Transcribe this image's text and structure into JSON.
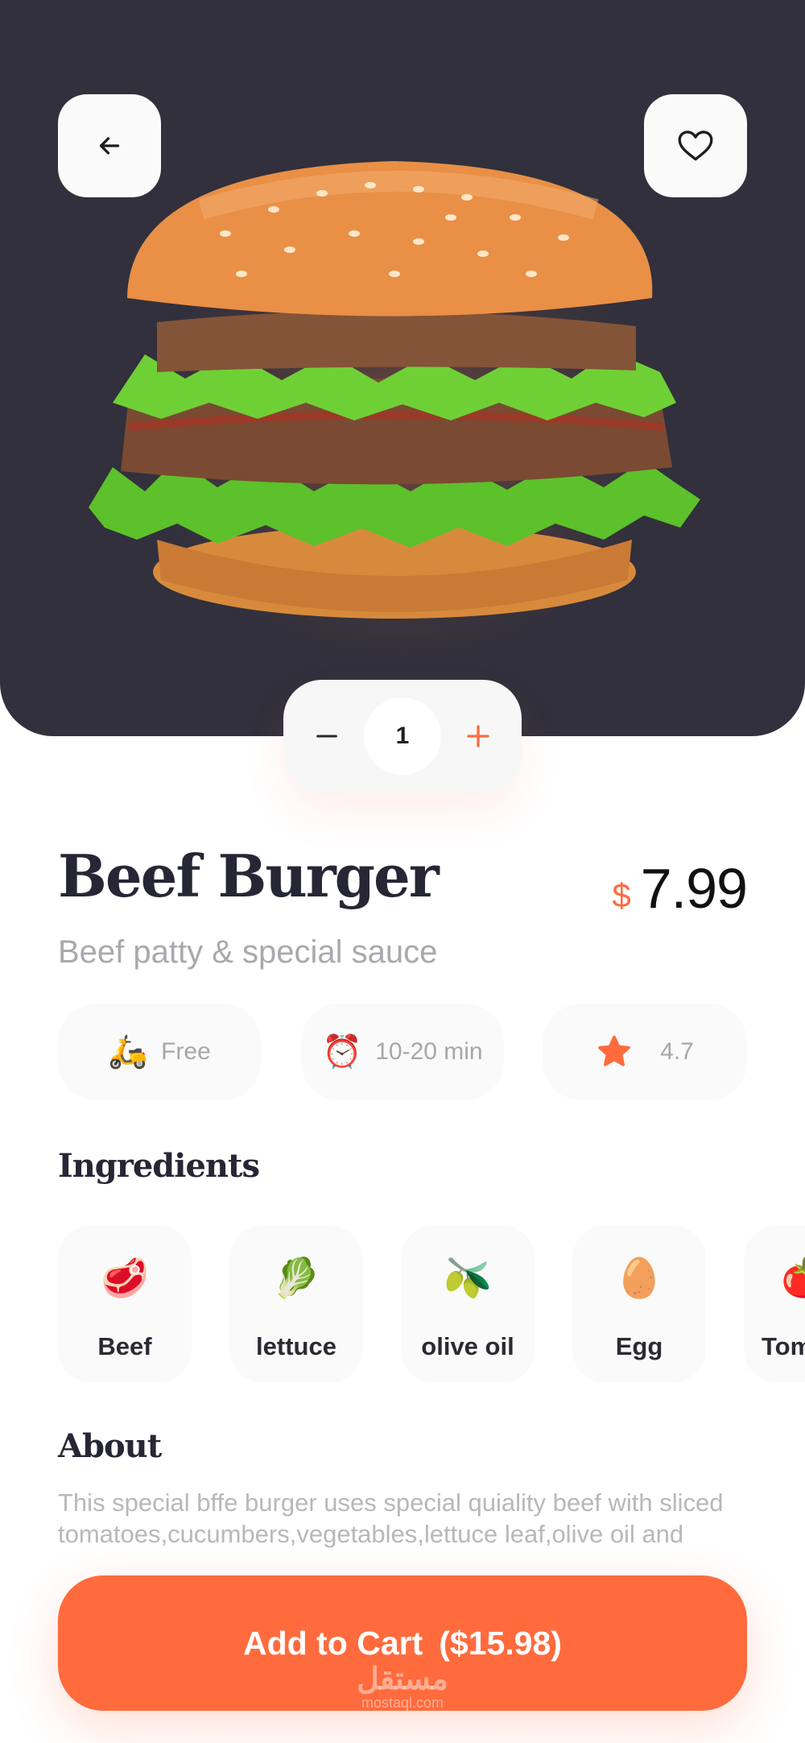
{
  "product": {
    "name": "Beef Burger",
    "description": "Beef patty & special sauce",
    "currency": "$",
    "price": "7.99",
    "quantity": "1"
  },
  "info": {
    "delivery": "Free",
    "time": "10-20 min",
    "rating": "4.7"
  },
  "sections": {
    "ingredients": "Ingredients",
    "about": "About"
  },
  "ingredients": [
    {
      "label": "Beef",
      "icon": "meat-icon"
    },
    {
      "label": "lettuce",
      "icon": "lettuce-icon"
    },
    {
      "label": "olive oil",
      "icon": "olive-oil-icon"
    },
    {
      "label": "Egg",
      "icon": "egg-icon"
    },
    {
      "label": "Tom",
      "icon": "tomato-icon"
    }
  ],
  "about": "This special bffe burger uses special quiality beef with sliced tomatoes,cucumbers,vegetables,lettuce leaf,olive oil and more.",
  "cart": {
    "label": "Add to Cart",
    "total": "($15.98)"
  },
  "watermark": {
    "arabic": "مستقل",
    "site": "mostaql.com"
  },
  "colors": {
    "accent": "#ff6b3d",
    "hero_bg": "#31303c",
    "card_bg": "#fafafa",
    "text_dark": "#272635",
    "text_muted": "#a9a9ad"
  }
}
